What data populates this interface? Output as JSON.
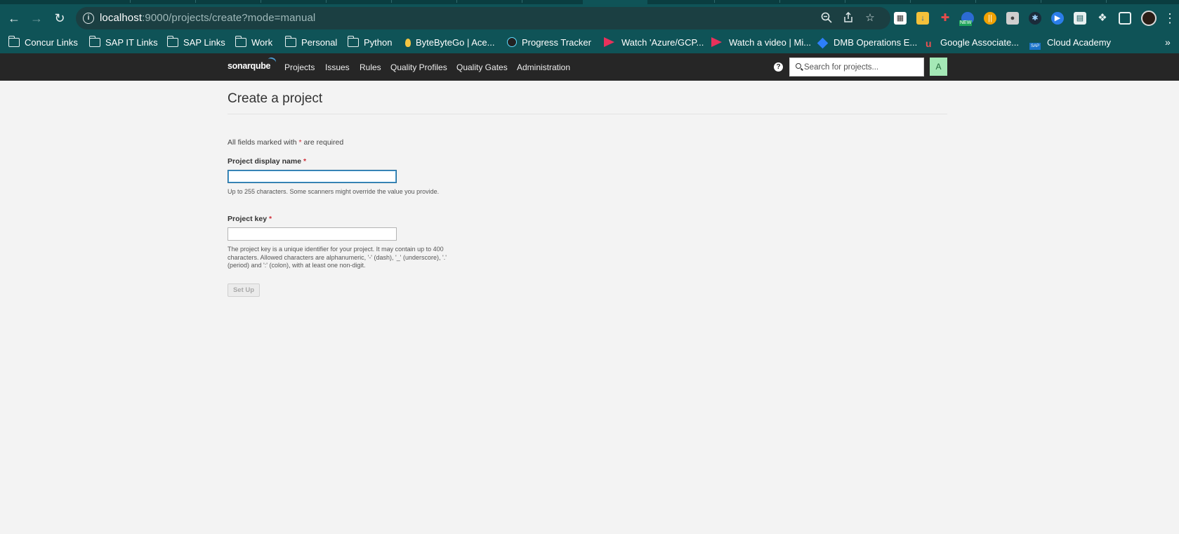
{
  "browser": {
    "url_host": "localhost",
    "url_rest": ":9000/projects/create?mode=manual",
    "bookmarks": [
      {
        "label": "Concur Links",
        "icon": "folder-icon"
      },
      {
        "label": "SAP IT Links",
        "icon": "folder-icon"
      },
      {
        "label": "SAP Links",
        "icon": "folder-icon"
      },
      {
        "label": "Work",
        "icon": "folder-icon"
      },
      {
        "label": "Personal",
        "icon": "folder-icon"
      },
      {
        "label": "Python",
        "icon": "folder-icon"
      },
      {
        "label": "ByteByteGo | Ace...",
        "icon": "bytebytego-icon"
      },
      {
        "label": "Progress Tracker",
        "icon": "react-icon"
      },
      {
        "label": "Watch 'Azure/GCP...",
        "icon": "play-arrow-icon"
      },
      {
        "label": "Watch a video | Mi...",
        "icon": "play-arrow-icon"
      },
      {
        "label": "DMB Operations E...",
        "icon": "diamond-icon"
      },
      {
        "label": "Google Associate...",
        "icon": "udemy-icon"
      },
      {
        "label": "Cloud Academy",
        "icon": "sap-icon"
      }
    ],
    "extension_badge": "NEW"
  },
  "sonar": {
    "logo_text": "sonarqube",
    "nav": [
      "Projects",
      "Issues",
      "Rules",
      "Quality Profiles",
      "Quality Gates",
      "Administration"
    ],
    "search_placeholder": "Search for projects...",
    "user_initial": "A"
  },
  "page": {
    "title": "Create a project",
    "required_note_prefix": "All fields marked with ",
    "required_star": "*",
    "required_note_suffix": " are required",
    "display_name_label": "Project display name",
    "display_name_value": "",
    "display_name_help": "Up to 255 characters. Some scanners might override the value you provide.",
    "key_label": "Project key",
    "key_value": "",
    "key_help": "The project key is a unique identifier for your project. It may contain up to 400 characters. Allowed characters are alphanumeric, '-' (dash), '_' (underscore), '.' (period) and ':' (colon), with at least one non-digit.",
    "setup_button": "Set Up"
  },
  "colors": {
    "browser_chrome": "#0f5357",
    "sonar_nav": "#262626",
    "required": "#d02f3a",
    "focus": "#236a97"
  }
}
